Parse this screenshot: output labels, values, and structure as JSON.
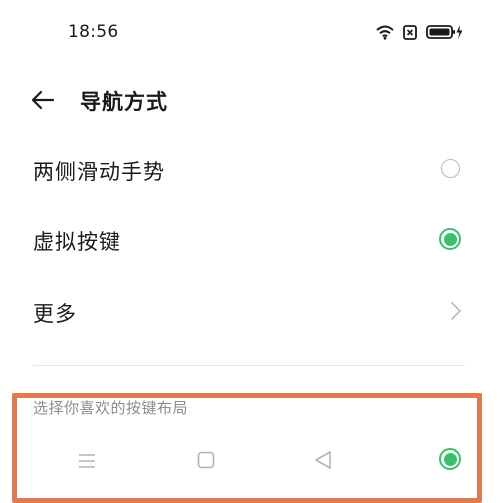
{
  "status_bar": {
    "time": "18:56"
  },
  "header": {
    "title": "导航方式"
  },
  "options": [
    {
      "label": "两侧滑动手势",
      "selected": false
    },
    {
      "label": "虚拟按键",
      "selected": true
    },
    {
      "label": "更多"
    }
  ],
  "button_layout": {
    "section_label": "选择你喜欢的按键布局",
    "selected": true
  },
  "colors": {
    "accent": "#3bbf6e",
    "highlight_border": "#e07a52"
  }
}
